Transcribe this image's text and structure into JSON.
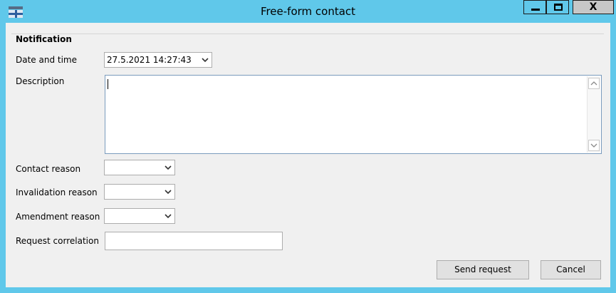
{
  "window": {
    "title": "Free-form contact",
    "close_label": "X"
  },
  "notification": {
    "group_title": "Notification",
    "date_time_label": "Date and time",
    "date_time_value": "27.5.2021 14:27:43",
    "description_label": "Description",
    "description_value": "",
    "contact_reason_label": "Contact reason",
    "contact_reason_value": "",
    "invalidation_reason_label": "Invalidation reason",
    "invalidation_reason_value": "",
    "amendment_reason_label": "Amendment reason",
    "amendment_reason_value": "",
    "request_correlation_label": "Request correlation",
    "request_correlation_value": ""
  },
  "buttons": {
    "send_request": "Send request",
    "cancel": "Cancel"
  },
  "colors": {
    "title_bar": "#60c8ea",
    "client_background": "#f0f0f0",
    "close_button": "#c7c7c7"
  }
}
